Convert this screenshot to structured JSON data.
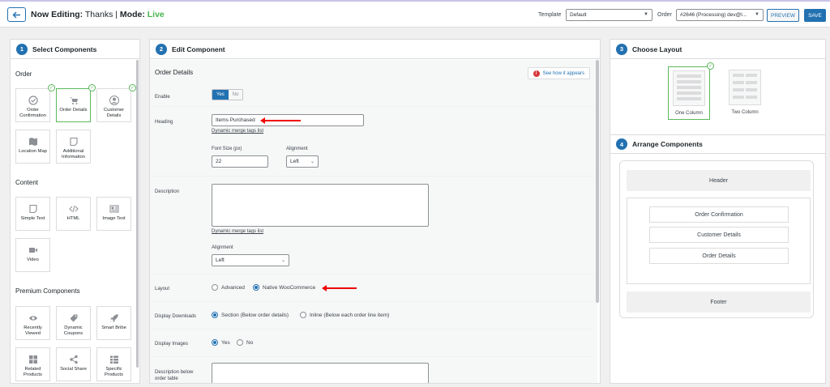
{
  "header": {
    "back_icon": "arrow-left-icon",
    "title_prefix": "Now Editing:",
    "title_name": "Thanks",
    "separator": "|",
    "mode_label": "Mode:",
    "mode_value": "Live",
    "template_label": "Template",
    "template_value": "Default",
    "order_label": "Order",
    "order_value": "#2646 (Processing) dev@l...",
    "preview_label": "PREVIEW",
    "save_label": "SAVE",
    "accent_color": "#2271b1",
    "live_color": "#46b450"
  },
  "select_components": {
    "step": "1",
    "title": "Select Components",
    "sections": [
      {
        "label": "Order",
        "items": [
          {
            "label": "Order Confirmation",
            "icon": "check-circle-icon",
            "selected": true
          },
          {
            "label": "Order Details",
            "icon": "cart-icon",
            "selected": true
          },
          {
            "label": "Customer Details",
            "icon": "user-icon",
            "selected": true
          },
          {
            "label": "Location Map",
            "icon": "map-icon",
            "selected": false
          },
          {
            "label": "Additional Information",
            "icon": "note-icon",
            "selected": false
          }
        ]
      },
      {
        "label": "Content",
        "items": [
          {
            "label": "Simple Text",
            "icon": "note-icon",
            "selected": false
          },
          {
            "label": "HTML",
            "icon": "code-icon",
            "selected": false
          },
          {
            "label": "Image Text",
            "icon": "image-text-icon",
            "selected": false
          },
          {
            "label": "Video",
            "icon": "video-icon",
            "selected": false
          }
        ]
      },
      {
        "label": "Premium Components",
        "items": [
          {
            "label": "Recently Viewed",
            "icon": "eye-icon",
            "selected": false
          },
          {
            "label": "Dynamic Coupons",
            "icon": "tag-icon",
            "selected": false
          },
          {
            "label": "Smart Bribe",
            "icon": "rocket-icon",
            "selected": false
          },
          {
            "label": "Related Products",
            "icon": "grid-icon",
            "selected": false
          },
          {
            "label": "Social Share",
            "icon": "share-icon",
            "selected": false
          },
          {
            "label": "Specific Products",
            "icon": "list-icon",
            "selected": false
          }
        ]
      }
    ]
  },
  "edit_component": {
    "step": "2",
    "title": "Edit Component",
    "section_title": "Order Details",
    "see_how_label": "See how it appears",
    "enable_label": "Enable",
    "enable_yes": "Yes",
    "enable_no": "No",
    "heading_label": "Heading",
    "heading_value": "Items Purchased",
    "merge_tags_link": "Dynamic merge tags list",
    "font_size_label": "Font Size (px)",
    "font_size_value": "22",
    "alignment_label": "Alignment",
    "alignment_value": "Left",
    "description_label": "Description",
    "description_value": "",
    "desc_merge_tags_link": "Dynamic merge tags list",
    "desc_alignment_label": "Alignment",
    "desc_alignment_value": "Left",
    "layout_label": "Layout",
    "layout_option_1": "Advanced",
    "layout_option_2": "Native WooCommerce",
    "layout_selected": "Native WooCommerce",
    "downloads_label": "Display Downloads",
    "downloads_option_1": "Section (Below order details)",
    "downloads_option_2": "Inline (Below each order line item)",
    "images_label": "Display Images",
    "images_option_1": "Yes",
    "images_option_2": "No",
    "desc_below_label": "Description below order table"
  },
  "choose_layout": {
    "step": "3",
    "title": "Choose Layout",
    "options": [
      {
        "label": "One Column",
        "selected": true
      },
      {
        "label": "Two Column",
        "selected": false
      }
    ]
  },
  "arrange_components": {
    "step": "4",
    "title": "Arrange Components",
    "header": "Header",
    "items": [
      "Order Confirmation",
      "Customer Details",
      "Order Details"
    ],
    "footer": "Footer"
  }
}
